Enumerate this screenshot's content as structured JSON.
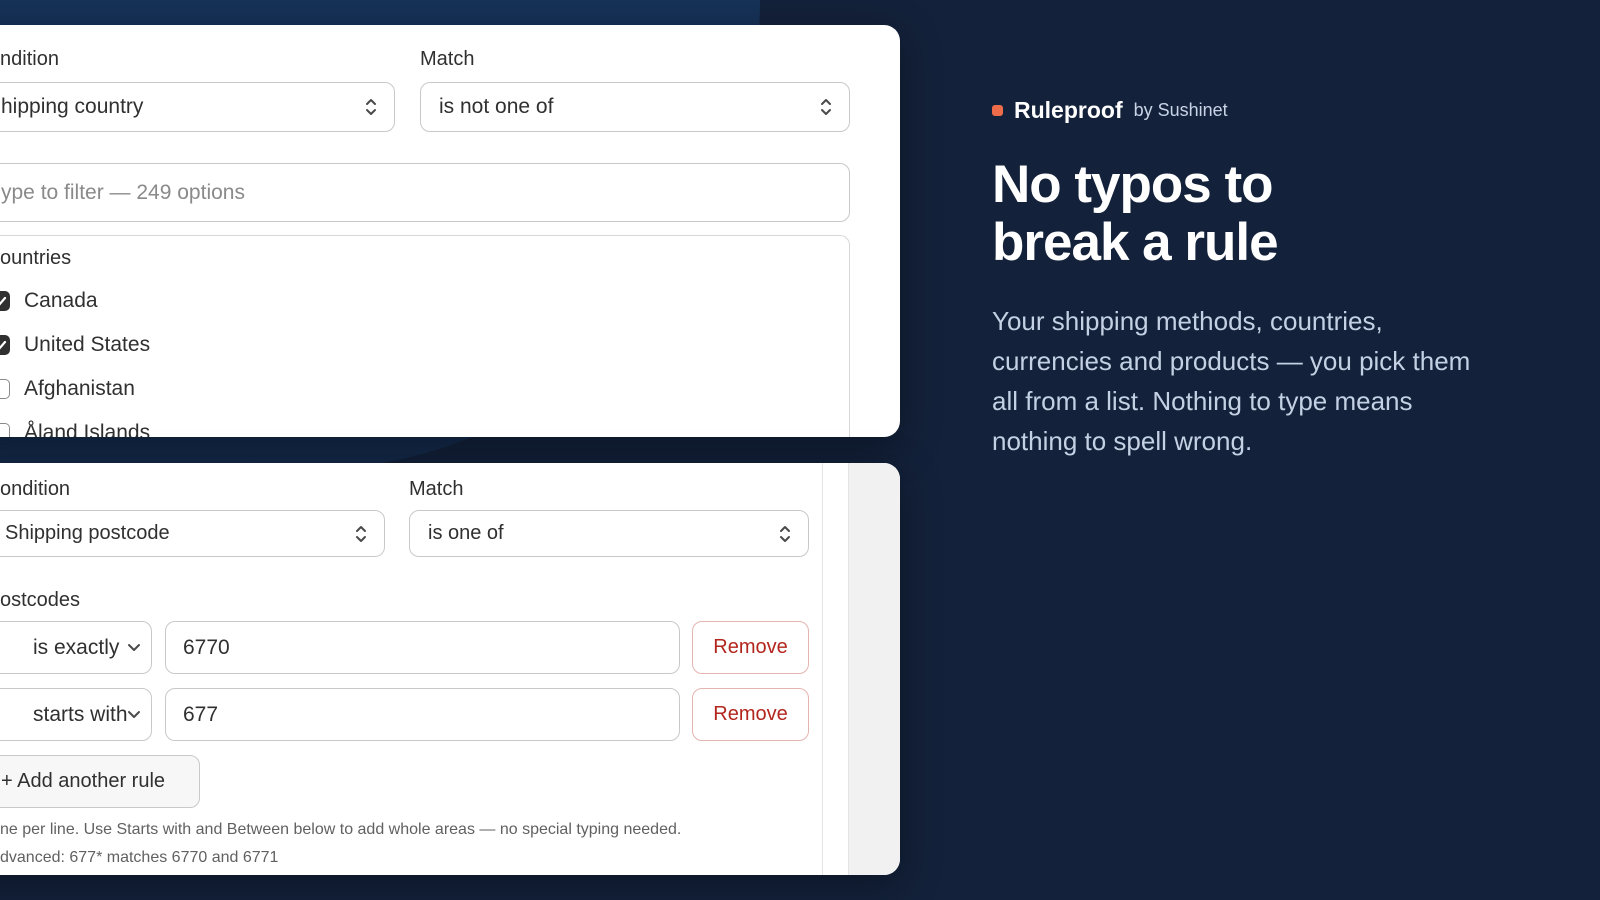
{
  "panel_country": {
    "condition_label": "ndition",
    "condition_value": "hipping country",
    "match_label": "Match",
    "match_value": "is not one of",
    "filter_placeholder": "ype to filter — 249 options",
    "group_label": "ountries",
    "options": [
      {
        "label": "Canada",
        "checked": true
      },
      {
        "label": "United States",
        "checked": true
      },
      {
        "label": "Afghanistan",
        "checked": false
      },
      {
        "label": "Åland Islands",
        "checked": false
      }
    ]
  },
  "panel_postcode": {
    "condition_label": "ondition",
    "condition_value": "Shipping postcode",
    "match_label": "Match",
    "match_value": "is one of",
    "section_label": "ostcodes",
    "rules": [
      {
        "operator": "is exactly",
        "value": "6770",
        "remove_label": "Remove"
      },
      {
        "operator": "starts with",
        "value": "677",
        "remove_label": "Remove"
      }
    ],
    "add_label": "+ Add another rule",
    "hint_line1": "ne per line. Use Starts with and Between below to add whole areas — no special typing needed.",
    "hint_line2": "dvanced: 677* matches 6770 and 6771"
  },
  "promo": {
    "brand_name": "Ruleproof",
    "brand_by": "by Sushinet",
    "headline_line1": "No typos to",
    "headline_line2": "break a rule",
    "body": "Your shipping methods, countries, currencies and products — you pick them all from a list. Nothing to type means nothing to spell wrong.",
    "accent_color": "#ef6c4a",
    "background_color": "#13213a"
  }
}
